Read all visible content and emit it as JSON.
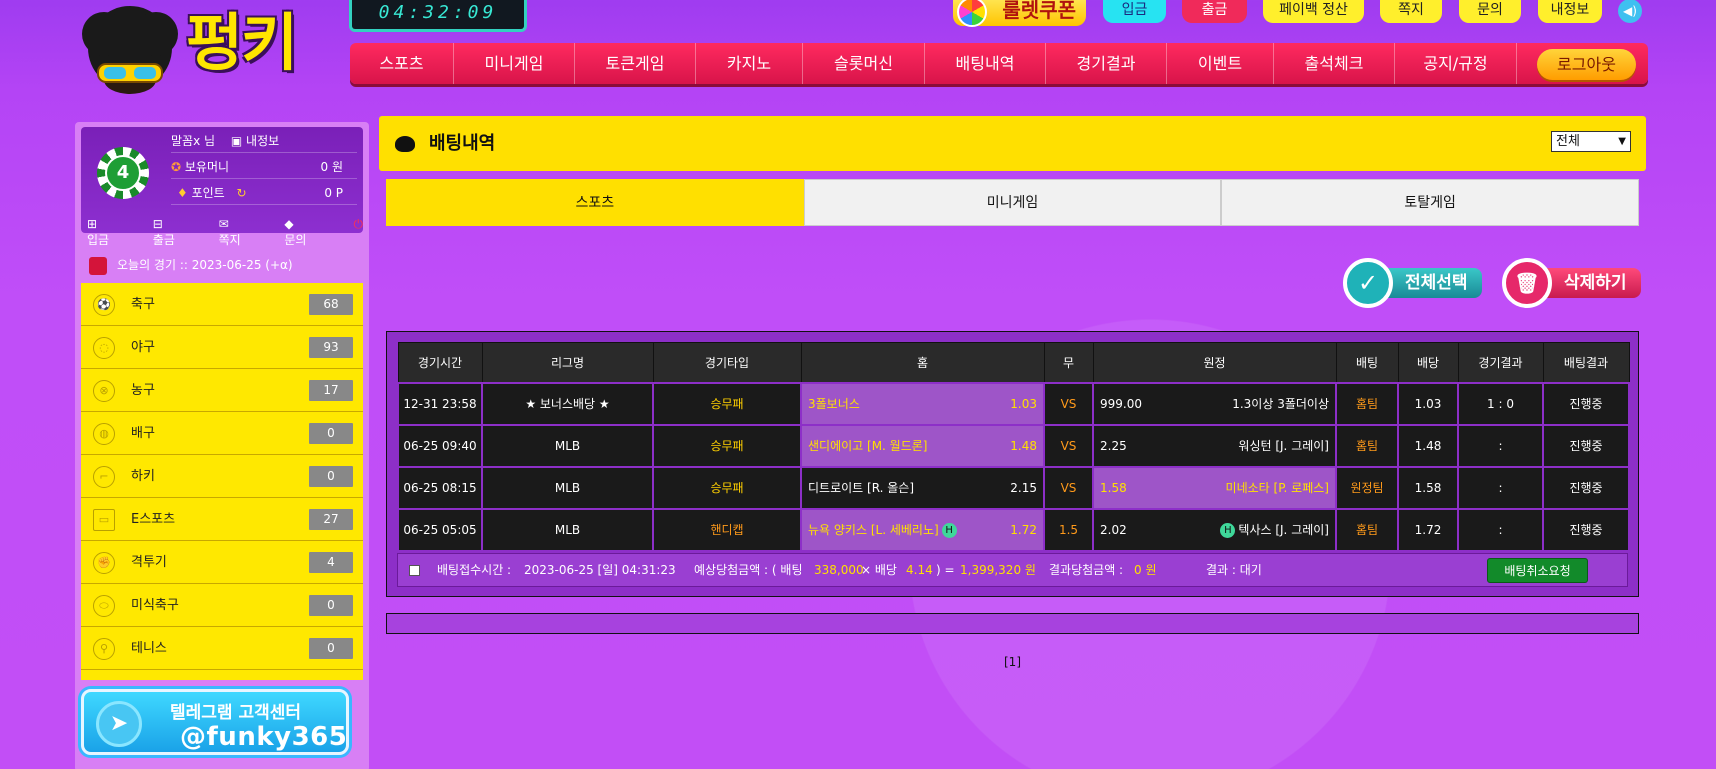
{
  "header": {
    "logo_text": "펑키",
    "clock": "04:32:09",
    "roulette_label": "룰렛쿠폰",
    "top_buttons": [
      {
        "label": "입금",
        "style": "cyan"
      },
      {
        "label": "출금",
        "style": "red"
      },
      {
        "label": "페이백 정산",
        "style": "yellow"
      },
      {
        "label": "쪽지",
        "style": "yellow"
      },
      {
        "label": "문의",
        "style": "yellow"
      },
      {
        "label": "내정보",
        "style": "yellow"
      }
    ],
    "nav": [
      "스포츠",
      "미니게임",
      "토큰게임",
      "카지노",
      "슬롯머신",
      "배팅내역",
      "경기결과",
      "이벤트",
      "출석체크",
      "공지/규정"
    ],
    "logout": "로그아웃"
  },
  "user": {
    "level": "4",
    "name": "말꼼x 님",
    "myinfo": "내정보",
    "money_label": "보유머니",
    "money_value": "0 원",
    "point_label": "포인트",
    "point_value": "0 P",
    "links": [
      "입금",
      "출금",
      "쪽지",
      "문의"
    ]
  },
  "sidebar": {
    "today": "오늘의 경기 :: 2023-06-25 (+α)",
    "sports": [
      {
        "name": "축구",
        "count": "68",
        "icon": "soccer-icon"
      },
      {
        "name": "야구",
        "count": "93",
        "icon": "baseball-icon"
      },
      {
        "name": "농구",
        "count": "17",
        "icon": "basketball-icon"
      },
      {
        "name": "배구",
        "count": "0",
        "icon": "volleyball-icon"
      },
      {
        "name": "하키",
        "count": "0",
        "icon": "hockey-icon"
      },
      {
        "name": "E스포츠",
        "count": "27",
        "icon": "esports-icon"
      },
      {
        "name": "격투기",
        "count": "4",
        "icon": "fighting-icon"
      },
      {
        "name": "미식축구",
        "count": "0",
        "icon": "football-icon"
      },
      {
        "name": "테니스",
        "count": "0",
        "icon": "tennis-icon"
      }
    ],
    "telegram_line1": "텔레그램 고객센터",
    "telegram_line2": "@funky365"
  },
  "main": {
    "title": "배팅내역",
    "filter_value": "전체",
    "tabs": [
      "스포츠",
      "미니게임",
      "토탈게임"
    ],
    "select_all": "전체선택",
    "delete": "삭제하기",
    "columns": [
      "경기시간",
      "리그명",
      "경기타입",
      "홈",
      "무",
      "원정",
      "배팅",
      "배당",
      "경기결과",
      "배팅결과"
    ],
    "rows": [
      {
        "time": "12-31 23:58",
        "league": "★ 보너스배당 ★",
        "type": "승무패",
        "home": "3폴보너스",
        "home_odds": "1.03",
        "home_h": "",
        "draw": "VS",
        "away_odds": "999.00",
        "away": "1.3이상 3폴더이상",
        "away_h": "",
        "pick": "홈팀",
        "odds": "1.03",
        "score": "1 : 0",
        "result": "진행중"
      },
      {
        "time": "06-25 09:40",
        "league": "MLB",
        "type": "승무패",
        "home": "샌디에이고 [M. 월드론]",
        "home_odds": "1.48",
        "home_h": "",
        "draw": "VS",
        "away_odds": "2.25",
        "away": "워싱턴 [J. 그레이]",
        "away_h": "",
        "pick": "홈팀",
        "odds": "1.48",
        "score": ":",
        "result": "진행중"
      },
      {
        "time": "06-25 08:15",
        "league": "MLB",
        "type": "승무패",
        "home": "디트로이트 [R. 올슨]",
        "home_odds": "2.15",
        "home_h": "",
        "draw": "VS",
        "away_odds": "1.58",
        "away": "미네소타 [P. 로페스]",
        "away_h": "",
        "pick": "원정팀",
        "odds": "1.58",
        "score": ":",
        "result": "진행중"
      },
      {
        "time": "06-25 05:05",
        "league": "MLB",
        "type": "핸디캡",
        "home": "뉴욕 양키스 [L. 세베리노]",
        "home_odds": "1.72",
        "home_h": "H",
        "draw": "1.5",
        "away_odds": "2.02",
        "away": "텍사스 [J. 그레이]",
        "away_h": "H",
        "pick": "홈팀",
        "odds": "1.72",
        "score": ":",
        "result": "진행중"
      }
    ],
    "summary": {
      "received_label": "배팅접수시간 :",
      "received": "2023-06-25 [일] 04:31:23",
      "expected_label": "예상당첨금액 : ( 배팅",
      "bet_amount": "338,000",
      "times": "× 배당",
      "total_odds": "4.14",
      "eq": ") =",
      "expected": "1,399,320 원",
      "won_label": "결과당첨금액 :",
      "won": "0 원",
      "result_label": "결과 : 대기",
      "cancel": "배팅취소요청"
    },
    "pager": "[1]"
  },
  "colors": {
    "accent_yellow": "#ffe000",
    "nav_red": "#e81d52",
    "purple_bg": "#c04ef8",
    "table_dark": "#1a1a1a",
    "selected_cell": "#9e55c8"
  }
}
